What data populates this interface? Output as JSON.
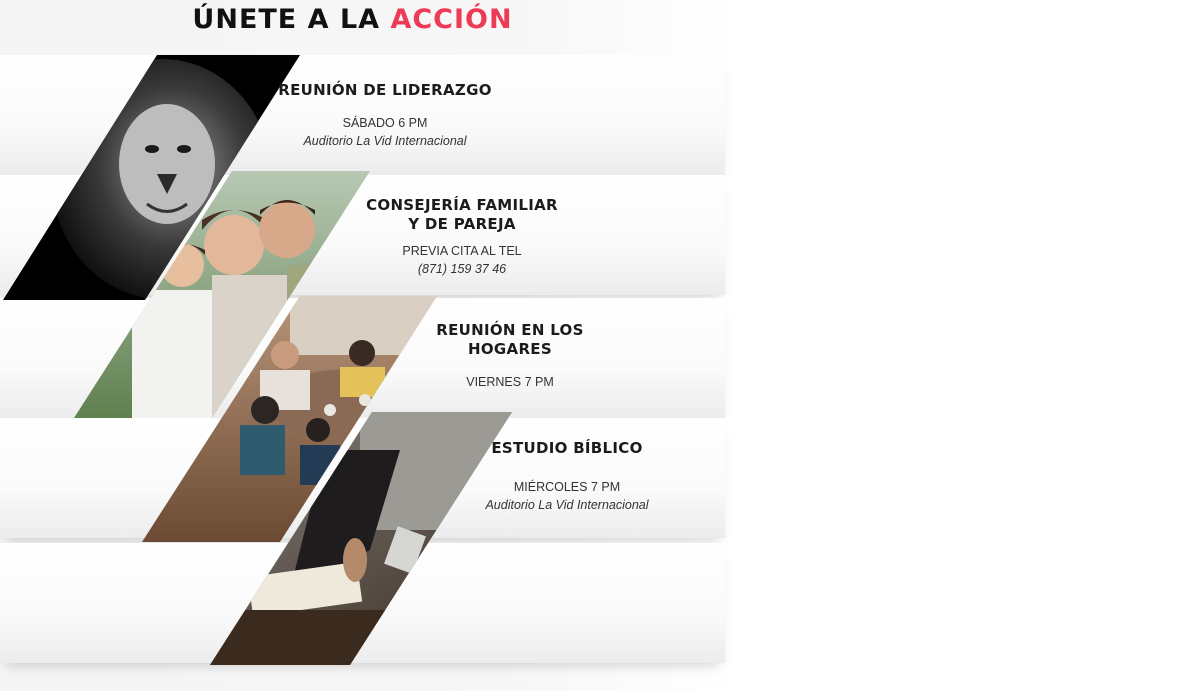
{
  "header": {
    "title_prefix": "ÚNETE A LA",
    "title_accent": "ACCIÓN",
    "accent_color": "#ee3a57"
  },
  "events": [
    {
      "title": "REUNIÓN DE LIDERAZGO",
      "line1": "SÁBADO 6 PM",
      "line2": "Auditorio La Vid Internacional",
      "image_icon": "lion-photo"
    },
    {
      "title": "CONSEJERÍA FAMILIAR\nY DE PAREJA",
      "line1": "PREVIA CITA AL TEL",
      "line2": "(871) 159 37 46",
      "image_icon": "family-photo"
    },
    {
      "title": "REUNIÓN EN LOS\nHOGARES",
      "line1": "VIERNES 7 PM",
      "line2": "",
      "image_icon": "home-group-photo"
    },
    {
      "title": "ESTUDIO BÍBLICO",
      "line1": "MIÉRCOLES 7 PM",
      "line2": "Auditorio La Vid Internacional",
      "image_icon": "bible-study-photo"
    }
  ]
}
